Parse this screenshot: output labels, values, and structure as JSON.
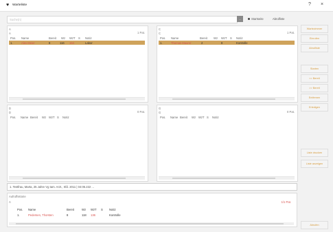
{
  "window": {
    "title": "Warteliste",
    "help": "?",
    "close": "×"
  },
  "search": {
    "placeholder": "Suche(n)",
    "go_label": "...",
    "radio_a": "Startseite",
    "radio_b": "Abrufliste"
  },
  "side_buttons": [
    "Wartezimmer",
    "Einrufen",
    "Abrufliste",
    "Starten",
    "<< Bereit",
    ">> Bereit",
    "Entfernen",
    "Erledigen",
    "Liste drucken",
    "Liste anzeigen",
    "Abrufen"
  ],
  "columns": [
    "Pos.",
    "Name",
    "Bereit",
    "Wz",
    "WzT",
    "S",
    "Notiz"
  ],
  "panels": [
    {
      "head": "A",
      "sub": "A",
      "count": "1 Pat.",
      "rows": [
        {
          "pos": "1.",
          "name": "Alex Meier",
          "bereit": "8",
          "wz": "116",
          "wzt": "164",
          "s": "",
          "notiz": "Labor"
        }
      ]
    },
    {
      "head": "C",
      "sub": "C",
      "count": "1 Pat.",
      "rows": [
        {
          "pos": "1.",
          "name": "Thomas Maurer",
          "bereit": "2",
          "wz": "",
          "wzt": "8",
          "s": "",
          "notiz": "Kontrolle"
        }
      ]
    },
    {
      "head": "D",
      "sub": "D",
      "count": "0 Pat.",
      "rows": []
    },
    {
      "head": "G",
      "sub": "G",
      "count": "0 Pat.",
      "rows": []
    }
  ],
  "status": {
    "text": "1. Testfrau, Marta, 25 Jahre Vg tam. Arzt., Sfd. 2011 | 04:05.222 ..."
  },
  "caller": {
    "title": "Aufrufhistorie",
    "sub": "A",
    "count": "1/1 Pat.",
    "row": {
      "pos": "1.",
      "name": "Pedersen, Thorsten",
      "bereit": "8",
      "wz": "118",
      "wzt": "136",
      "s": "",
      "notiz": "Kontrolle"
    }
  }
}
